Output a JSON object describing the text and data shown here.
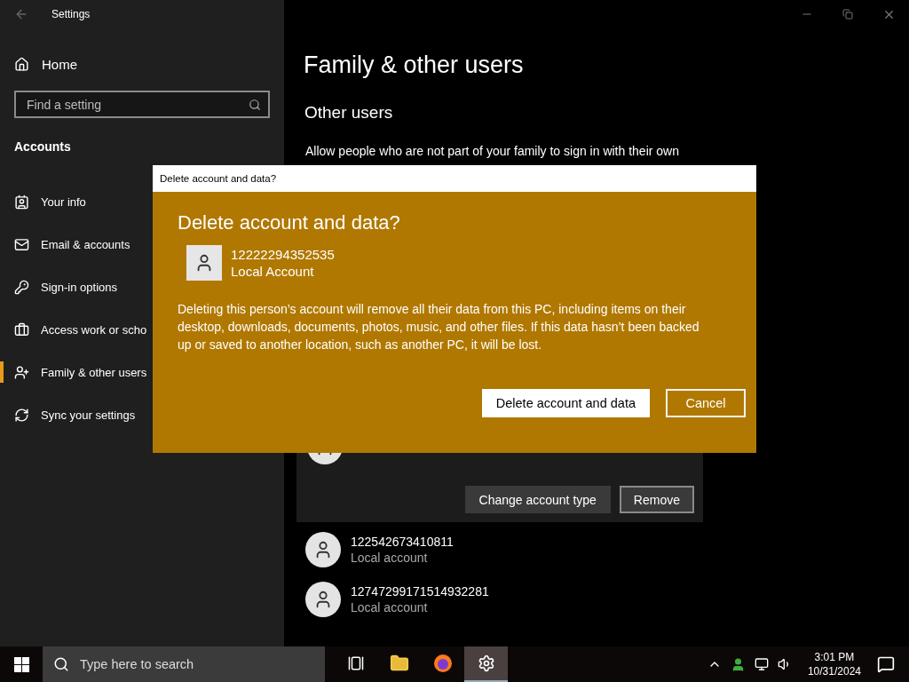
{
  "window": {
    "title": "Settings"
  },
  "sidebar": {
    "home": "Home",
    "search": {
      "placeholder": "Find a setting"
    },
    "section": "Accounts",
    "items": [
      {
        "label": "Your info",
        "selected": false
      },
      {
        "label": "Email & accounts",
        "selected": false
      },
      {
        "label": "Sign-in options",
        "selected": false
      },
      {
        "label": "Access work or scho",
        "selected": false
      },
      {
        "label": "Family & other users",
        "selected": true
      },
      {
        "label": "Sync your settings",
        "selected": false
      }
    ]
  },
  "content": {
    "title": "Family & other users",
    "section": "Other users",
    "description": "Allow people who are not part of your family to sign in with their own",
    "expanded_user": {
      "buttons": [
        "Change account type",
        "Remove"
      ]
    },
    "users": [
      {
        "name": "122542673410811",
        "type": "Local account"
      },
      {
        "name": "12747299171514932281",
        "type": "Local account"
      }
    ]
  },
  "dialog": {
    "caption": "Delete account and data?",
    "heading": "Delete account and data?",
    "account": {
      "name": "12222294352535",
      "type": "Local Account"
    },
    "message": "Deleting this person’s account will remove all their data from this PC, including items on their desktop, downloads, documents, photos, music, and other files. If this data hasn’t been backed up or saved to another location, such as another PC, it will be lost.",
    "buttons": [
      {
        "label": "Delete account and data",
        "primary": true
      },
      {
        "label": "Cancel",
        "primary": false
      }
    ]
  },
  "taskbar": {
    "search": {
      "placeholder": "Type here to search"
    },
    "apps": [
      {
        "selected": false
      },
      {
        "selected": false
      },
      {
        "selected": false
      },
      {
        "selected": true
      }
    ],
    "clock": {
      "time": "3:01 PM",
      "date": "10/31/2024"
    }
  }
}
